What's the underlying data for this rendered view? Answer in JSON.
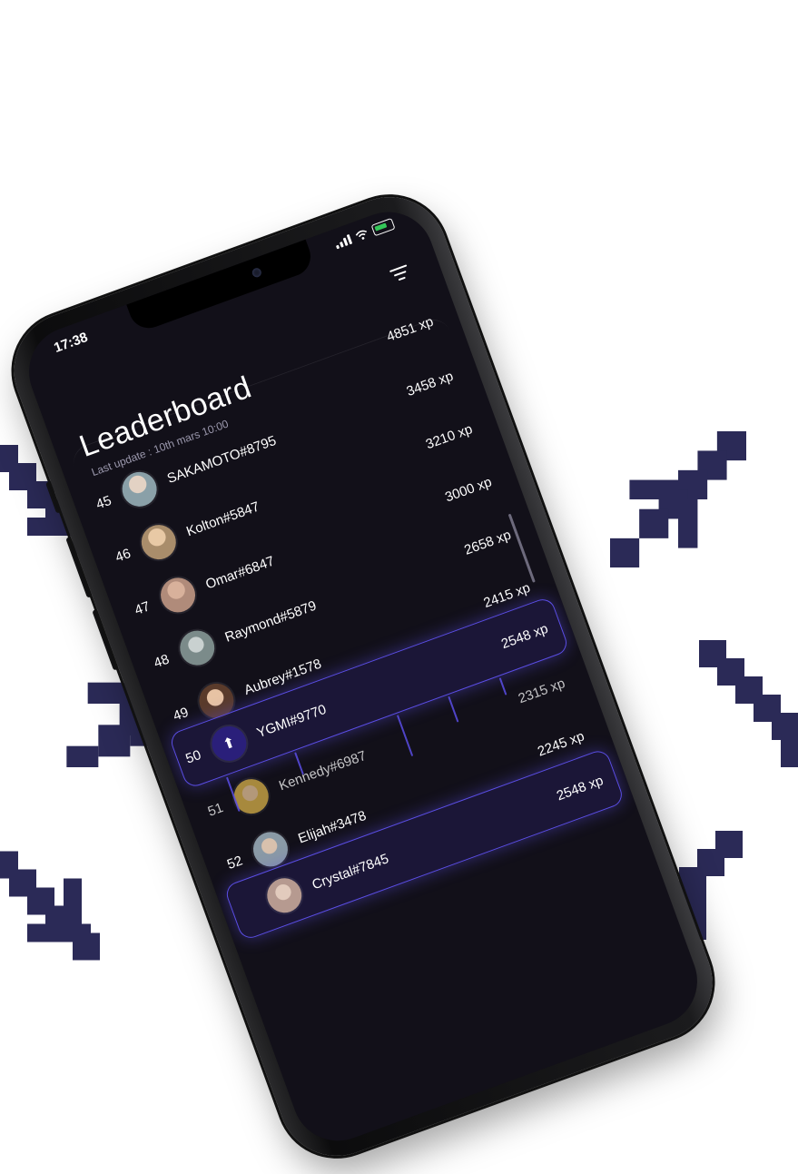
{
  "status_bar": {
    "time": "17:38"
  },
  "header": {
    "title": "Leaderboard",
    "subtitle": "Last update : 10th mars 10:00"
  },
  "leaderboard": [
    {
      "rank": "",
      "name": "",
      "xp": "4851 xp",
      "avatar_color": "#7a6a8d"
    },
    {
      "rank": "45",
      "name": "SAKAMOTO#8795",
      "xp": "3458 xp",
      "avatar_color": "#8aa0a8"
    },
    {
      "rank": "46",
      "name": "Kolton#5847",
      "xp": "3210 xp",
      "avatar_color": "#a98d6b"
    },
    {
      "rank": "47",
      "name": "Omar#6847",
      "xp": "3000 xp",
      "avatar_color": "#b08b7a"
    },
    {
      "rank": "48",
      "name": "Raymond#5879",
      "xp": "2658 xp",
      "avatar_color": "#7b8b8a"
    },
    {
      "rank": "49",
      "name": "Aubrey#1578",
      "xp": "2415 xp",
      "avatar_color": "#c9a080"
    },
    {
      "rank": "51",
      "name": "Kennedy#6987",
      "xp": "2315 xp",
      "avatar_color": "#d9b24a"
    },
    {
      "rank": "52",
      "name": "Elijah#3478",
      "xp": "2245 xp",
      "avatar_color": "#8a9aa6"
    },
    {
      "rank": "",
      "name": "Crystal#7845",
      "xp": "",
      "avatar_color": "#b69a90"
    }
  ],
  "current_user": {
    "rank": "50",
    "name": "YGMI#9770",
    "xp": "2548 xp",
    "badge_icon": "arrow-up-icon"
  },
  "current_user_bottom": {
    "xp": "2548 xp"
  },
  "colors": {
    "sword": "#2b2a57",
    "accent": "#5b4ee6",
    "screen_bg": "#121019"
  }
}
